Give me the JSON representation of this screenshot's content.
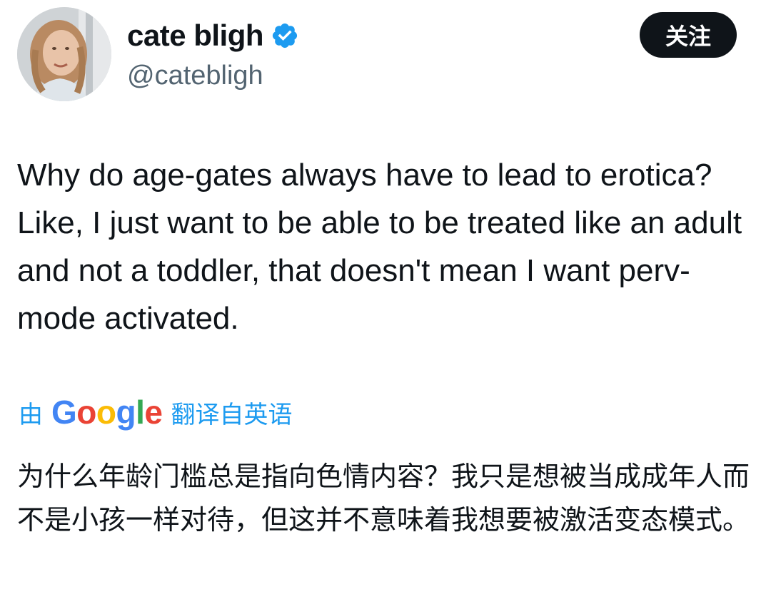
{
  "author": {
    "display_name": "cate bligh",
    "handle": "@catebligh",
    "verified": true,
    "avatar_icon": "profile-photo"
  },
  "actions": {
    "follow_label": "关注"
  },
  "tweet": {
    "text": "Why do age-gates always have to lead to erotica? Like, I just want to be able to be treated like an adult and not a toddler, that doesn't mean I want perv-mode activated."
  },
  "translation": {
    "prefix": "由",
    "provider": "Google",
    "suffix": "翻译自英语",
    "text": "为什么年龄门槛总是指向色情内容？我只是想被当成成年人而不是小孩一样对待，但这并不意味着我想要被激活变态模式。"
  },
  "colors": {
    "verified_badge": "#1d9bf0",
    "link": "#1d9bf0",
    "follow_button_bg": "#0f1419",
    "text_primary": "#0f1419",
    "text_secondary": "#536471"
  }
}
